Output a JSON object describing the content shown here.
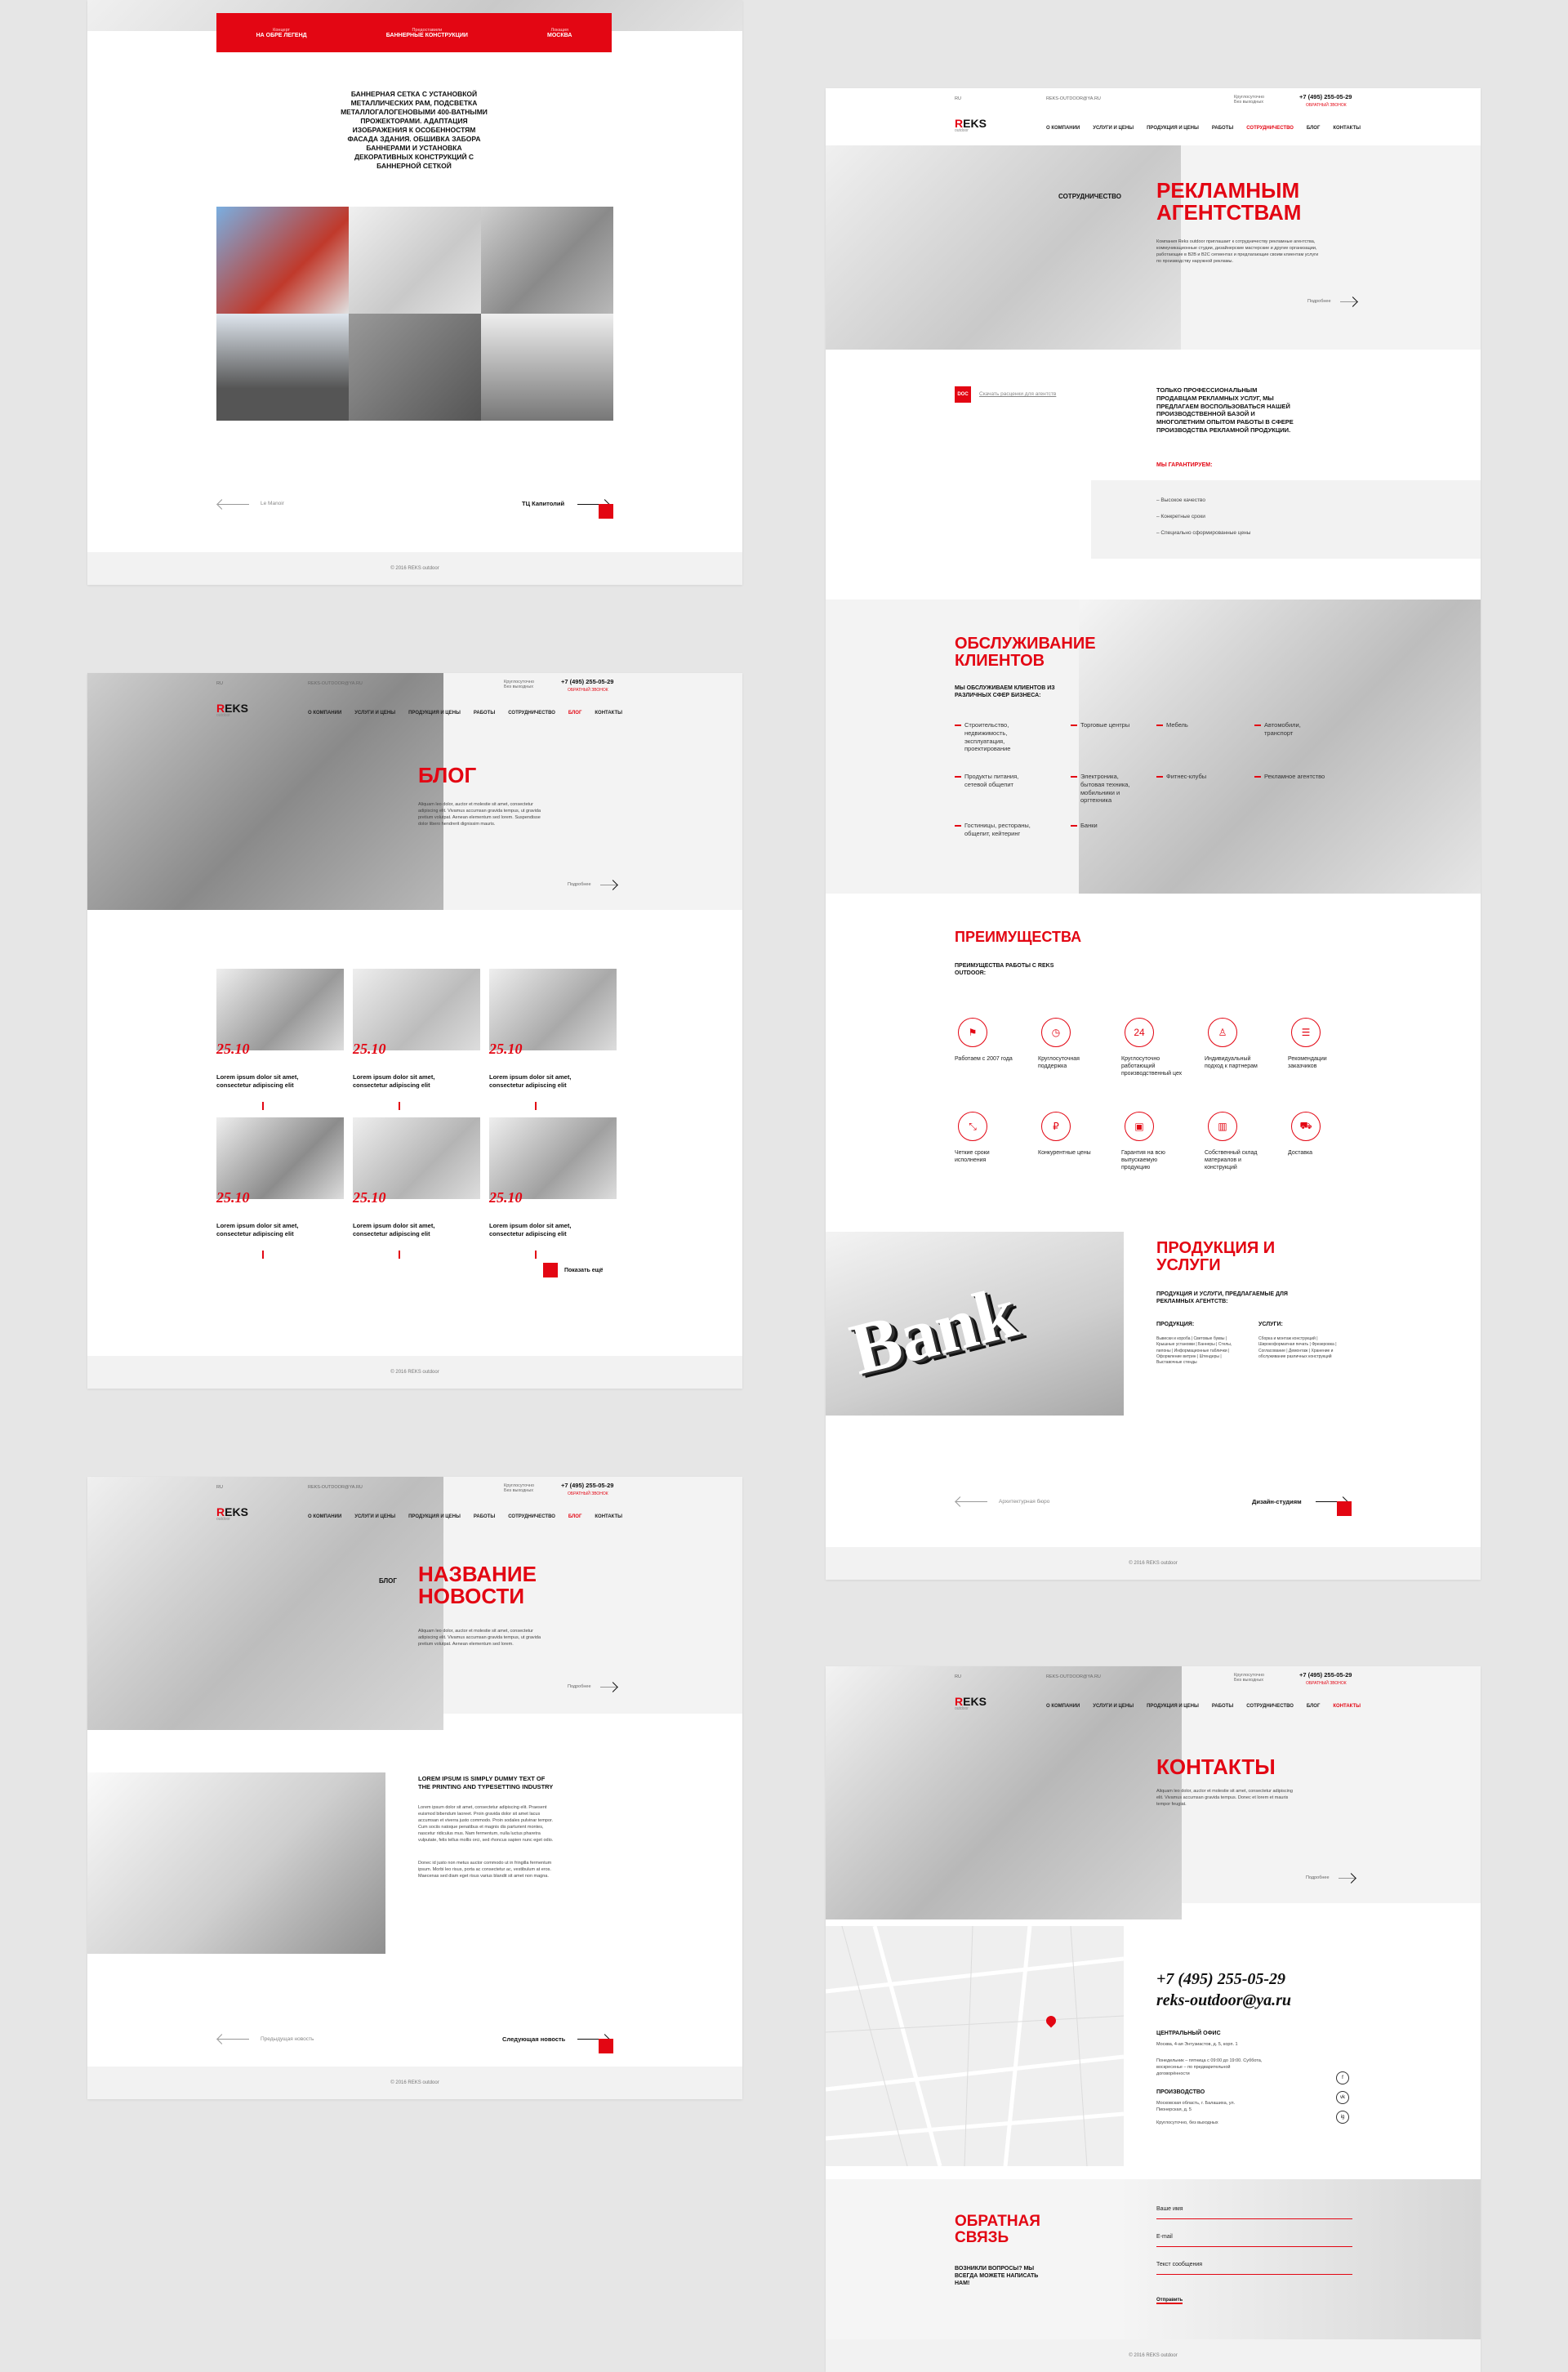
{
  "card1": {
    "header_cols": [
      {
        "top": "Концерт",
        "bottom": "НА ОБРЕ ЛЕГЕНД"
      },
      {
        "top": "Предоставили",
        "bottom": "БАННЕРНЫЕ КОНСТРУКЦИИ"
      },
      {
        "top": "Локация",
        "bottom": "МОСКВА"
      }
    ],
    "description": "БАННЕРНАЯ СЕТКА С УСТАНОВКОЙ МЕТАЛЛИЧЕСКИХ РАМ, ПОДСВЕТКА МЕТАЛЛОГАЛОГЕНОВЫМИ 400-ВАТНЫМИ ПРОЖЕКТОРАМИ. АДАПТАЦИЯ ИЗОБРАЖЕНИЯ К ОСОБЕННОСТЯМ ФАСАДА ЗДАНИЯ. ОБШИВКА ЗАБОРА БАННЕРАМИ И УСТАНОВКА ДЕКОРАТИВНЫХ КОНСТРУКЦИЙ С БАННЕРНОЙ СЕТКОЙ",
    "prev": "Le Manoir",
    "next": "ТЦ Капитолий",
    "footer": "© 2016 REKS outdoor"
  },
  "card2": {
    "lang": "RU",
    "site": "REKS-OUTDOOR@YA.RU",
    "workhours": "Круглосуточно\nБез выходных",
    "phone": "+7 (495) 255-05-29",
    "callback": "ОБРАТНЫЙ ЗВОНОК",
    "nav": [
      "О КОМПАНИИ",
      "УСЛУГИ И ЦЕНЫ",
      "ПРОДУКЦИЯ И ЦЕНЫ",
      "РАБОТЫ",
      "СОТРУДНИЧЕСТВО",
      "БЛОГ",
      "КОНТАКТЫ"
    ],
    "crumb": "СОТРУДНИЧЕСТВО",
    "title": "РЕКЛАМНЫМ АГЕНТСТВАМ",
    "intro": "Компания Reks outdoor приглашает к сотрудничеству рекламные агентства, коммуникационные студии, дизайнерские мастерские и другие организации, работающие в B2B и B2C сегментах и предлагающие своим клиентам услуги по производству наружной рекламы.",
    "more": "Подробнее",
    "doc_badge": "DOC",
    "doc_link": "Скачать расценки для агентств",
    "offer": "ТОЛЬКО ПРОФЕССИОНАЛЬНЫМ ПРОДАВЦАМ РЕКЛАМНЫХ УСЛУГ, МЫ ПРЕДЛАГАЕМ ВОСПОЛЬЗОВАТЬСЯ НАШЕЙ ПРОИЗВОДСТВЕННОЙ БАЗОЙ И МНОГОЛЕТНИМ ОПЫТОМ РАБОТЫ В СФЕРЕ ПРОИЗВОДСТВА РЕКЛАМНОЙ ПРОДУКЦИИ.",
    "guarantee": "МЫ ГАРАНТИРУЕМ:",
    "guarantees": [
      "Высокое качество",
      "Конкретные сроки",
      "Специально сформированные цены"
    ],
    "service_title": "ОБСЛУЖИВАНИЕ КЛИЕНТОВ",
    "service_sub": "МЫ ОБСЛУЖИВАЕМ КЛИЕНТОВ ИЗ РАЗЛИЧНЫХ СФЕР БИЗНЕСА:",
    "spheres": [
      "Строительство, недвижимость, эксплуатация, проектирование",
      "Торговые центры",
      "Мебель",
      "Автомобили, транспорт",
      "Продукты питания, сетевой общепит",
      "Электроника, бытовая техника, мобильники и оргтехника",
      "Фитнес-клубы",
      "Рекламное агентство",
      "Гостиницы, рестораны, общепит, кейтеринг",
      "Банки"
    ],
    "adv_title": "ПРЕИМУЩЕСТВА",
    "adv_sub": "ПРЕИМУЩЕСТВА РАБОТЫ С REKS OUTDOOR:",
    "advantages": [
      {
        "icon": "flag-icon",
        "glyph": "⚑",
        "label": "Работаем с 2007 года"
      },
      {
        "icon": "clock-icon",
        "glyph": "◷",
        "label": "Круглосуточная поддержка"
      },
      {
        "icon": "calendar-icon",
        "glyph": "24",
        "label": "Круглосуточно работающий производственный цех"
      },
      {
        "icon": "person-icon",
        "glyph": "♙",
        "label": "Индивидуальный подход к партнерам"
      },
      {
        "icon": "list-icon",
        "glyph": "☰",
        "label": "Рекомендации заказчиков"
      },
      {
        "icon": "route-icon",
        "glyph": "⤡",
        "label": "Четкие сроки исполнения"
      },
      {
        "icon": "ruble-icon",
        "glyph": "₽",
        "label": "Конкурентные цены"
      },
      {
        "icon": "guarantee-icon",
        "glyph": "▣",
        "label": "Гарантия на всю выпускаемую продукцию"
      },
      {
        "icon": "warehouse-icon",
        "glyph": "▥",
        "label": "Собственный склад материалов и конструкций"
      },
      {
        "icon": "truck-icon",
        "glyph": "⛟",
        "label": "Доставка"
      }
    ],
    "prod_title": "ПРОДУКЦИЯ И УСЛУГИ",
    "prod_sub": "ПРОДУКЦИЯ И УСЛУГИ, ПРЕДЛАГАЕМЫЕ ДЛЯ РЕКЛАМНЫХ АГЕНТСТВ:",
    "prod_col1_title": "ПРОДУКЦИЯ:",
    "prod_col2_title": "УСЛУГИ:",
    "prod_col1": "Вывески и короба | Световые буквы | Крышные установки | Баннеры | Стелы, пилоны | Информационные таблички | Оформление витрин | Штендеры | Выставочные стенды",
    "prod_col2": "Сборка и монтаж конструкций | Широкоформатная печать | Фрезеровка | Согласование | Демонтаж | Хранение и обслуживание различных конструкций",
    "bank_word": "Bank",
    "prev": "Архитектурная бюро",
    "next": "Дизайн-студиям",
    "footer": "© 2016 REKS outdoor"
  },
  "card3": {
    "lang": "RU",
    "site": "REKS-OUTDOOR@YA.RU",
    "workhours": "Круглосуточно\nБез выходных",
    "phone": "+7 (495) 255-05-29",
    "callback": "ОБРАТНЫЙ ЗВОНОК",
    "nav": [
      "О КОМПАНИИ",
      "УСЛУГИ И ЦЕНЫ",
      "ПРОДУКЦИЯ И ЦЕНЫ",
      "РАБОТЫ",
      "СОТРУДНИЧЕСТВО",
      "БЛОГ",
      "КОНТАКТЫ"
    ],
    "title": "БЛОГ",
    "intro": "Aliquam leo dolor, auctor et molestie sit amet, consectetur adipiscing elit. Vivamus accumsan gravida tempus, ut gravida pretium volutpat. Aenean elementum sed lorem. Suspendisse dolor libero hendrerit dignissim mauris.",
    "more": "Подробнее",
    "posts": [
      {
        "date": "25.10",
        "title": "Lorem ipsum dolor sit amet, consectetur adipiscing elit"
      },
      {
        "date": "25.10",
        "title": "Lorem ipsum dolor sit amet, consectetur adipiscing elit"
      },
      {
        "date": "25.10",
        "title": "Lorem ipsum dolor sit amet, consectetur adipiscing elit"
      },
      {
        "date": "25.10",
        "title": "Lorem ipsum dolor sit amet, consectetur adipiscing elit"
      },
      {
        "date": "25.10",
        "title": "Lorem ipsum dolor sit amet, consectetur adipiscing elit"
      },
      {
        "date": "25.10",
        "title": "Lorem ipsum dolor sit amet, consectetur adipiscing elit"
      }
    ],
    "show_more": "Показать ещё",
    "footer": "© 2016 REKS outdoor"
  },
  "card4": {
    "lang": "RU",
    "site": "REKS-OUTDOOR@YA.RU",
    "workhours": "Круглосуточно\nБез выходных",
    "phone": "+7 (495) 255-05-29",
    "callback": "ОБРАТНЫЙ ЗВОНОК",
    "nav": [
      "О КОМПАНИИ",
      "УСЛУГИ И ЦЕНЫ",
      "ПРОДУКЦИЯ И ЦЕНЫ",
      "РАБОТЫ",
      "СОТРУДНИЧЕСТВО",
      "БЛОГ",
      "КОНТАКТЫ"
    ],
    "crumb": "БЛОГ",
    "title": "НАЗВАНИЕ НОВОСТИ",
    "intro": "Aliquam leo dolor, auctor et molestie sit amet, consectetur adipiscing elit. Vivamus accumsan gravida tempus, ut gravida pretium volutpat. Aenean elementum sed lorem.",
    "more": "Подробнее",
    "article_head": "LOREM IPSUM IS SIMPLY DUMMY TEXT OF THE PRINTING AND TYPESETTING INDUSTRY",
    "article_body": "Lorem ipsum dolor sit amet, consectetur adipiscing elit. Praesent euismod bibendum laoreet. Proin gravida dolor sit amet lacus accumsan et viverra justo commodo. Proin sodales pulvinar tempor. Cum sociis natoque penatibus et magnis dis parturient montes, nascetur ridiculus mus. Nam fermentum, nulla luctus pharetra vulputate, felis tellus mollis orci, sed rhoncus sapien nunc eget odio.",
    "article_body2": "Donec id justo non metus auctor commodo ut in fringilla fermentum ipsum. Morbi leo risus, porta ac consectetur ac, vestibulum at eros. Maecenas sed diam eget risus varius blandit sit amet non magna.",
    "prev": "Предыдущая новость",
    "next": "Следующая новость",
    "footer": "© 2016 REKS outdoor"
  },
  "card5": {
    "lang": "RU",
    "site": "REKS-OUTDOOR@YA.RU",
    "workhours": "Круглосуточно\nБез выходных",
    "phone": "+7 (495) 255-05-29",
    "callback": "ОБРАТНЫЙ ЗВОНОК",
    "nav": [
      "О КОМПАНИИ",
      "УСЛУГИ И ЦЕНЫ",
      "ПРОДУКЦИЯ И ЦЕНЫ",
      "РАБОТЫ",
      "СОТРУДНИЧЕСТВО",
      "БЛОГ",
      "КОНТАКТЫ"
    ],
    "title": "КОНТАКТЫ",
    "intro": "Aliquam leo dolor, auctor et molestie sit amet, consectetur adipiscing elit. Vivamus accumsan gravida tempus. Donec et lorem et mauris tempor feugiat.",
    "more": "Подробнее",
    "big_phone": "+7 (495) 255-05-29",
    "big_email": "reks-outdoor@ya.ru",
    "office_title": "ЦЕНТРАЛЬНЫЙ ОФИС",
    "office_addr": "Москва, 4-ая Энтузиастов, д. 5, корп. 1",
    "office_hours": "Понедельник – пятница с 09:00 до 19:00. Суббота, воскресенье – по предварительной договорённости",
    "prod_title": "ПРОИЗВОДСТВО",
    "prod_addr": "Московская область, г. Балашиха, ул. Пионерская, д. 5",
    "prod_hours": "Круглосуточно, без выходных",
    "social": [
      "f",
      "vk",
      "ig"
    ],
    "feedback_title": "ОБРАТНАЯ СВЯЗЬ",
    "feedback_sub": "ВОЗНИКЛИ ВОПРОСЫ? МЫ ВСЕГДА МОЖЕТЕ НАПИСАТЬ НАМ!",
    "field_name": "Ваше имя",
    "field_email": "E-mail",
    "field_msg": "Текст сообщения",
    "send": "Отправить",
    "footer": "© 2016 REKS outdoor"
  },
  "logo": {
    "r": "R",
    "rest": "EKS",
    "sub": "outdoor"
  },
  "colors": {
    "accent": "#e30613",
    "bg": "#e6e6e6",
    "footer": "#f2f2f2"
  }
}
